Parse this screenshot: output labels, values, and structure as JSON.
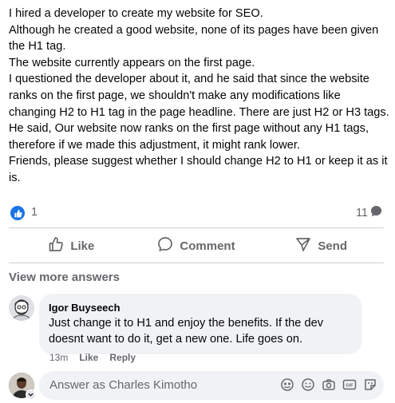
{
  "post": {
    "lines": [
      "I hired a developer to create my website for SEO.",
      "Although he created a good website, none of its pages have been given the H1 tag.",
      "The website currently appears on the first page.",
      "I questioned the developer about it, and he said that since the website ranks on the first page, we shouldn't make any modifications like changing H2 to H1 tag in the page headline. There are just H2 or H3 tags.",
      "He said, Our website now ranks on the first page without any H1 tags, therefore if we made this adjustment, it might rank lower.",
      "Friends, please suggest whether I should change H2 to H1 or keep it as it is."
    ]
  },
  "reactions": {
    "like_count": "1",
    "comment_count": "11"
  },
  "actions": {
    "like": "Like",
    "comment": "Comment",
    "send": "Send"
  },
  "view_more": "View more answers",
  "comment": {
    "author": "Igor Buyseech",
    "text": "Just change it to H1 and enjoy the benefits. If the dev doesnt want to do it, get a new one. Life goes on.",
    "time": "13m",
    "like": "Like",
    "reply": "Reply"
  },
  "answer_box": {
    "placeholder": "Answer as Charles Kimotho"
  },
  "colors": {
    "accent": "#1b74e4",
    "secondary_text": "#65676b",
    "bubble": "#f0f2f5"
  }
}
